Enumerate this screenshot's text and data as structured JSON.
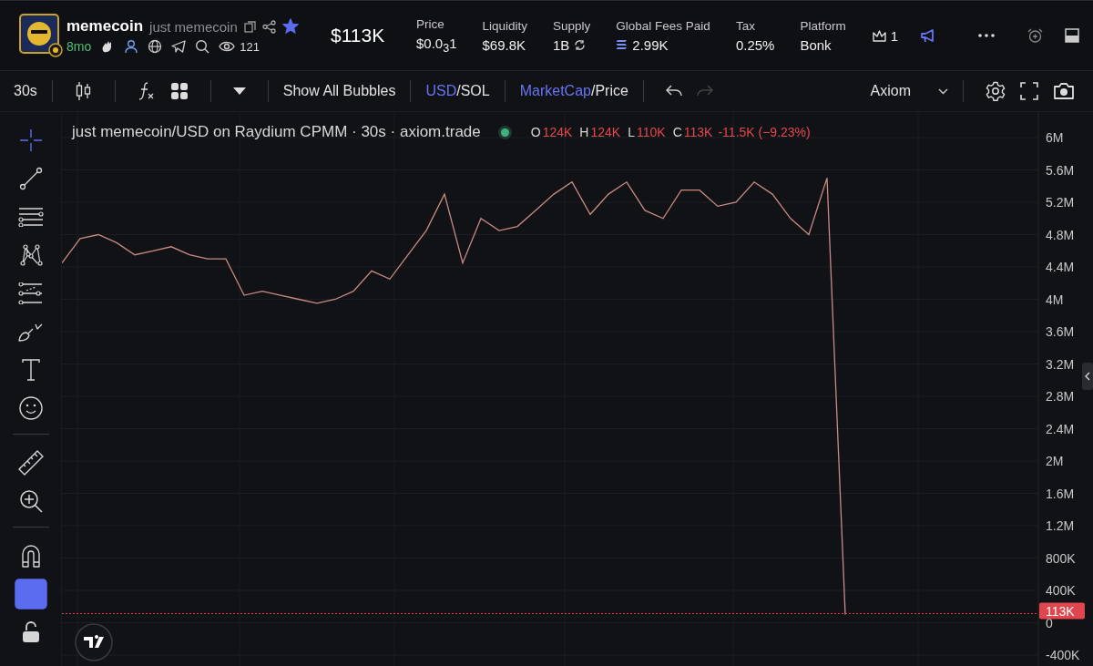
{
  "header": {
    "name": "memecoin",
    "full_name": "just memecoin",
    "favorite": true,
    "age": "8mo",
    "views": "121",
    "market_cap": "$113K",
    "stats": [
      {
        "kind": "plain",
        "label": "Price",
        "value": "$0.0$_{3}$1"
      },
      {
        "kind": "plain",
        "label": "Liquidity",
        "value": "$69.8K"
      },
      {
        "kind": "refresh",
        "label": "Supply",
        "value": "1B"
      },
      {
        "kind": "coin",
        "label": "Global Fees Paid",
        "value": "2.99K"
      },
      {
        "kind": "plain",
        "label": "Tax",
        "value": "0.25%"
      },
      {
        "kind": "plain",
        "label": "Platform",
        "value": "Bonk"
      }
    ],
    "crown_count": "1"
  },
  "toolbar": {
    "interval": "30s",
    "bubbles": "Show All Bubbles",
    "currency": {
      "separator": "/",
      "options": [
        {
          "label": "USD",
          "selected": true
        },
        {
          "label": "SOL",
          "selected": false
        }
      ]
    },
    "metric": {
      "separator": "/",
      "options": [
        {
          "label": "MarketCap",
          "selected": true
        },
        {
          "label": "Price",
          "selected": false
        }
      ]
    },
    "redo_disabled": true,
    "source": "Axiom"
  },
  "tools": [
    {
      "kind": "crosshair",
      "selected": true
    },
    {
      "kind": "trend-line",
      "selected": false
    },
    {
      "kind": "lines",
      "selected": false
    },
    {
      "kind": "pattern",
      "selected": false
    },
    {
      "kind": "forecast",
      "selected": false
    },
    {
      "kind": "brush",
      "selected": false
    },
    {
      "kind": "text",
      "selected": false
    },
    {
      "kind": "emoji",
      "selected": false
    },
    {
      "kind": "divider"
    },
    {
      "kind": "ruler",
      "selected": false
    },
    {
      "kind": "zoom",
      "selected": false
    },
    {
      "kind": "divider"
    },
    {
      "kind": "magnet",
      "selected": false
    },
    {
      "kind": "square",
      "selected": true
    },
    {
      "kind": "lock",
      "selected": false
    }
  ],
  "legend": {
    "title": "just memecoin/USD on Raydium CPMM · 30s · axiom.trade",
    "ohlc": [
      {
        "key": "O",
        "value": "124K"
      },
      {
        "key": "H",
        "value": "124K"
      },
      {
        "key": "L",
        "value": "110K"
      },
      {
        "key": "C",
        "value": "113K"
      }
    ],
    "change": "-11.5K (−9.23%)"
  },
  "chart_data": {
    "type": "line",
    "grid": true,
    "ylim": [
      -400000,
      6000000
    ],
    "yticks": [
      {
        "value": 6000000,
        "label": "6M"
      },
      {
        "value": 5600000,
        "label": "5.6M"
      },
      {
        "value": 5200000,
        "label": "5.2M"
      },
      {
        "value": 4800000,
        "label": "4.8M"
      },
      {
        "value": 4400000,
        "label": "4.4M"
      },
      {
        "value": 4000000,
        "label": "4M"
      },
      {
        "value": 3600000,
        "label": "3.6M"
      },
      {
        "value": 3200000,
        "label": "3.2M"
      },
      {
        "value": 2800000,
        "label": "2.8M"
      },
      {
        "value": 2400000,
        "label": "2.4M"
      },
      {
        "value": 2000000,
        "label": "2M"
      },
      {
        "value": 1600000,
        "label": "1.6M"
      },
      {
        "value": 1200000,
        "label": "1.2M"
      },
      {
        "value": 800000,
        "label": "800K"
      },
      {
        "value": 400000,
        "label": "400K"
      },
      {
        "value": 0,
        "label": "0"
      },
      {
        "value": -400000,
        "label": "-400K"
      }
    ],
    "ref_lines": [
      {
        "axis": "y",
        "value": 113000,
        "label": "113K",
        "color": "#e0464e"
      }
    ],
    "series": [
      {
        "color": "#c98a84",
        "values": [
          4450000,
          4750000,
          4800000,
          4700000,
          4550000,
          4600000,
          4650000,
          4550000,
          4500000,
          4500000,
          4050000,
          4100000,
          4050000,
          4000000,
          3950000,
          4000000,
          4100000,
          4350000,
          4250000,
          4550000,
          4850000,
          5300000,
          4450000,
          5000000,
          4850000,
          4900000,
          5100000,
          5300000,
          5450000,
          5050000,
          5300000,
          5450000,
          5100000,
          5000000,
          5350000,
          5350000,
          5150000,
          5200000,
          5450000,
          5300000,
          5000000,
          4800000,
          5500000,
          100000
        ]
      }
    ]
  }
}
